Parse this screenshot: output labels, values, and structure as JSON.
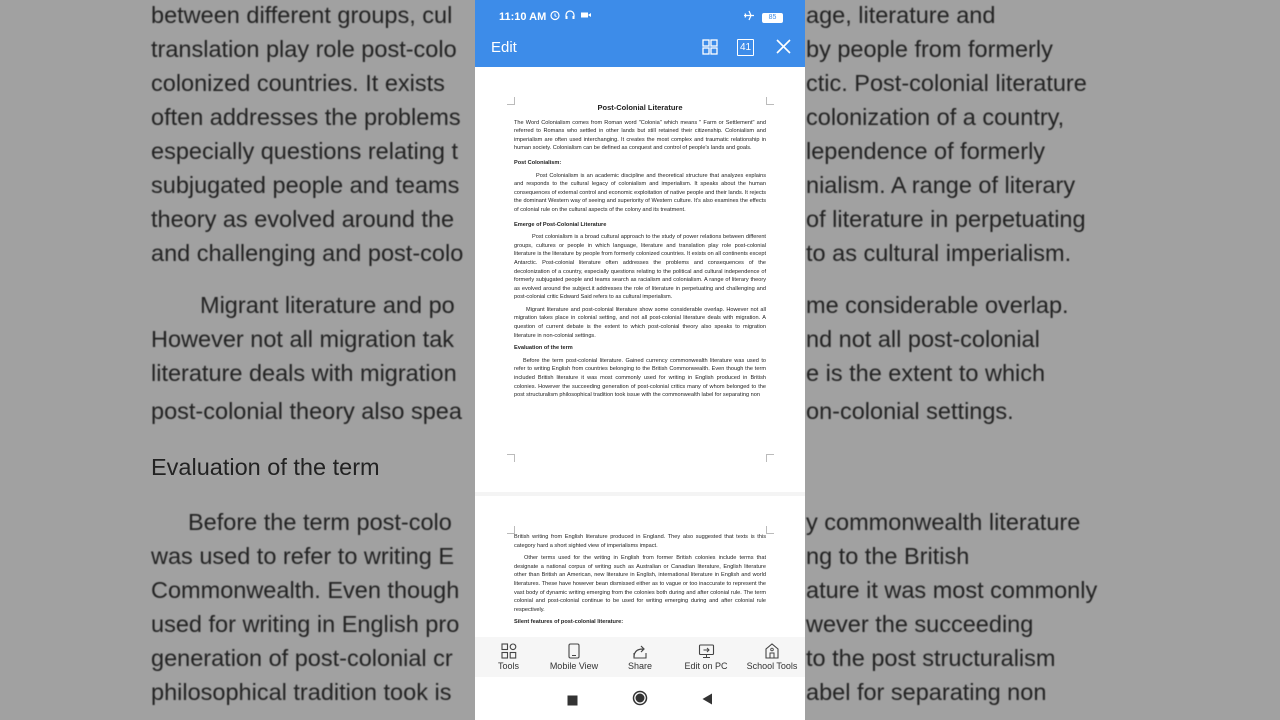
{
  "background": {
    "lines_top": [
      "between different groups, cul",
      "translation play role post-colo",
      "colonized countries. It exists",
      "often addresses the problems",
      "especially questions relating t",
      "subjugated people and teams",
      "theory as evolved around the",
      "and challenging and post-colo"
    ],
    "lines_right": [
      "age, literature and",
      "by people from formerly",
      "ctic. Post-colonial literature",
      "colonization of a country,",
      "lependence of formerly",
      "nialism. A range of literary",
      "of literature in perpetuating",
      "to as cultural imperialism."
    ],
    "mid_left": [
      "Migrant literature and po",
      "However not all migration tak",
      "literature deals with migration",
      "post-colonial theory also spea"
    ],
    "mid_right": [
      "me considerable overlap.",
      "nd not all post-colonial",
      "e is the extent to which",
      "on-colonial settings."
    ],
    "heading": "Evaluation of the term",
    "low_left": [
      "Before the term post-colo",
      "was used to refer to writing E",
      "Commonwealth. Even though",
      "used for writing in English pro",
      "generation of post-colonial cr",
      "philosophical tradition took is"
    ],
    "low_right": [
      "y commonwealth literature",
      "ng to the British",
      "ature it was most commonly",
      "wever the succeeding",
      "to the post structuralism",
      "abel for separating non"
    ]
  },
  "status": {
    "time": "11:10 AM",
    "battery": "85"
  },
  "appbar": {
    "edit_label": "Edit",
    "page_count": "41"
  },
  "doc": {
    "title": "Post-Colonial Literature",
    "intro": "The Word Colonialism comes from Roman word \"Colonia\" which means \" Farm or Settlement\" and referred to Romans who settled in other lands but still retained their citizenship. Colonialism and imperialism are often used interchanging. It creates the most complex and traumatic relationship in human society. Colonialism can be defined as conquest and control of people's lands and goals.",
    "h_post": "Post Colonialism:",
    "p_post": "Post Colonialism is an academic discipline and theoretical structure that analyzes explains and responds to the cultural legacy of colonialism and imperialism. It speaks about the human consequences of external control and economic exploitation of native people and their lands. It rejects the dominant Western way of seeing and superiority of Western culture. It's also examines the effects of colonial rule on the cultural aspects of the colony and its treatment.",
    "h_emerge": "Emerge of Post-Colonial Literature",
    "p_emerge": "Post colonialism is a broad cultural approach to the study of power relations between different groups, cultures or people in which language, literature and translation play role post-colonial literature is the literature by people from formerly colonized countries. It exists on all continents except Antarctic. Post-colonial literature often addresses the problems and consequences of the decolonization of a country, especially questions relating to the political and cultural independence of formerly subjugated people and teams search as racialism and colonialism. A range of literary theory as evolved around the subject.it addresses the role of literature in perpetuating and challenging and post-colonial critic Edward Said refers to as cultural imperialism.",
    "p_migrant": "Migrant literature and post-colonial literature show some considerable overlap. However not all migration takes place in colonial setting, and not all post-colonial literature deals with migration. A question of current debate is the extent to which post-colonial theory also speaks to migration literature in non-colonial settings.",
    "h_eval": "Evaluation of the term",
    "p_eval": "Before the term post-colonial literature. Gained currency commonwealth literature was used to refer to writing English from countries belonging to the British Commonwealth. Even though the term included British literature it was most commonly used for writing in English produced in British colonies. However the succeeding generation of post-colonial critics many of whom belonged to the post structuralism philosophical tradition took issue with the commonwealth label for separating non",
    "p2_a": "British writing from English literature produced in England. They also suggested that texts is this category hard a short sighted view of imperialisms impact.",
    "p2_b": "Other terms used for the writing in English from former British colonies include terms that designate a national corpus of writing such as Australian or Canadian literature, English literature other than British an American, new literature in English, international literature in English and world literatures. These have however bean dismissed either as to vague or too inaccurate to represent the vast body of dynamic writing emerging from the colonies both during and after colonial rule. The term colonial and post-colonial continue to be used for writing emerging during and after colonial rule respectively.",
    "h2_c": "Silent features of post-colonial literature:"
  },
  "toolbar": {
    "tools": "Tools",
    "mobile_view": "Mobile View",
    "share": "Share",
    "edit_on_pc": "Edit on PC",
    "school_tools": "School Tools"
  },
  "colors": {
    "accent": "#3d8ce9",
    "background_blur": "#a1a1a1"
  }
}
